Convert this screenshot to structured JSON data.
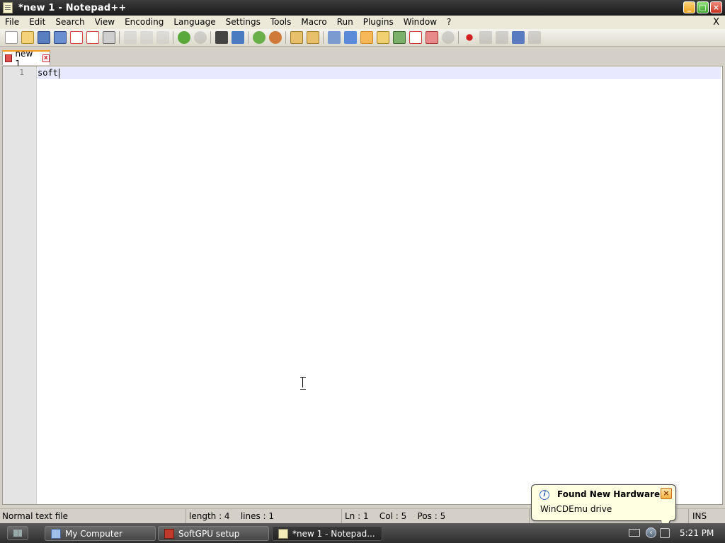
{
  "window": {
    "title": "*new 1 - Notepad++",
    "controls": {
      "minimize": "_",
      "maximize": "□",
      "close": "×"
    }
  },
  "menu": {
    "items": [
      "File",
      "Edit",
      "Search",
      "View",
      "Encoding",
      "Language",
      "Settings",
      "Tools",
      "Macro",
      "Run",
      "Plugins",
      "Window",
      "?"
    ],
    "close": "X"
  },
  "toolbar": {
    "icons": [
      "new-file-icon",
      "open-file-icon",
      "save-icon",
      "save-all-icon",
      "close-file-icon",
      "close-all-icon",
      "print-icon",
      "cut-icon",
      "copy-icon",
      "paste-icon",
      "undo-icon",
      "redo-icon",
      "find-icon",
      "replace-icon",
      "zoom-in-icon",
      "zoom-out-icon",
      "sync-vertical-icon",
      "sync-horizontal-icon",
      "word-wrap-icon",
      "show-all-chars-icon",
      "indent-guide-icon",
      "user-defined-language-icon",
      "document-map-icon",
      "function-list-icon",
      "folder-workspace-icon",
      "monitoring-icon",
      "record-macro-icon",
      "stop-macro-icon",
      "play-macro-icon",
      "run-macro-multiple-icon",
      "save-macro-icon"
    ],
    "accent": "#f59a1c"
  },
  "tabs": [
    {
      "label": "new 1",
      "close": "x"
    }
  ],
  "editor": {
    "lines": [
      {
        "number": "1",
        "text": "soft"
      }
    ],
    "current_line_color": "#e8e8ff"
  },
  "status": {
    "file_type": "Normal text file",
    "length": "length : 4",
    "lines": "lines : 1",
    "ln": "Ln : 1",
    "col": "Col : 5",
    "pos": "Pos : 5",
    "mode": "INS"
  },
  "balloon": {
    "title": "Found New Hardware",
    "text": "WinCDEmu drive",
    "info_glyph": "i",
    "close": "×"
  },
  "taskbar": {
    "tasks": [
      {
        "label": "My Computer",
        "icon": "computer-icon"
      },
      {
        "label": "SoftGPU setup",
        "icon": "setup-icon"
      },
      {
        "label": "*new 1 - Notepad...",
        "icon": "notepad-icon"
      }
    ],
    "clock": "5:21 PM",
    "tray_arrow": "‹"
  }
}
